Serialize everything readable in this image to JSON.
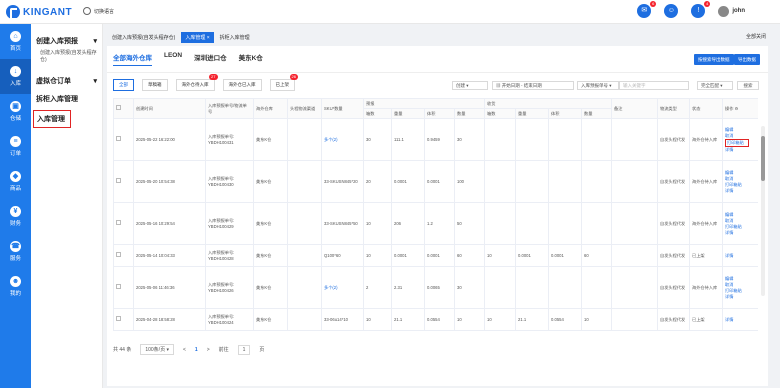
{
  "brand": {
    "name": "KINGANT",
    "lang_label": "切换语言"
  },
  "header": {
    "badges": [
      "6",
      "",
      "4"
    ],
    "user": "john"
  },
  "sidebar": [
    {
      "label": "首页",
      "icon": "home-icon"
    },
    {
      "label": "入库",
      "icon": "inbound-icon"
    },
    {
      "label": "仓储",
      "icon": "warehouse-icon"
    },
    {
      "label": "订单",
      "icon": "order-icon"
    },
    {
      "label": "商品",
      "icon": "goods-icon"
    },
    {
      "label": "财务",
      "icon": "finance-icon"
    },
    {
      "label": "服务",
      "icon": "service-icon"
    },
    {
      "label": "我的",
      "icon": "user-icon"
    }
  ],
  "submenu": {
    "s1": "创建入库预报",
    "s1_child": "创建入库预报(自发头程存仓)",
    "s2": "虚拟仓订单",
    "s3": "拆柜入库管理",
    "s4": "入库管理"
  },
  "page_tabs": [
    "创建入库预报(自发头程存仓)",
    "入库管理",
    "拆柜入库管理"
  ],
  "close_all": "全部关闭",
  "warehouse_tabs": [
    "全部海外仓库",
    "LEON",
    "深圳进口仓",
    "美东K仓"
  ],
  "actions": {
    "export_current": "按搜索导出数据",
    "export_all": "导出数据"
  },
  "filters": [
    {
      "label": "全部",
      "badge": ""
    },
    {
      "label": "草稿箱",
      "badge": ""
    },
    {
      "label": "海外仓待入库",
      "badge": "27"
    },
    {
      "label": "海外仓已入库",
      "badge": ""
    },
    {
      "label": "已上架",
      "badge": "26"
    }
  ],
  "search": {
    "date_type": "创建",
    "date_from": "开始日期",
    "date_sep": "-",
    "date_to": "结束日期",
    "field": "入库预报单号",
    "placeholder": "输入关键字",
    "match": "完全匹配",
    "button": "搜索"
  },
  "table": {
    "headers": [
      "创建时间",
      "入库预报单号/物流单号",
      "海外仓库",
      "头程物流渠道",
      "SKU*数量",
      "预报",
      "收货",
      "备注",
      "物流类型",
      "状态",
      "操作"
    ],
    "sub_headers": [
      "箱数",
      "重量",
      "体积",
      "数量",
      "箱数",
      "重量",
      "体积",
      "数量"
    ],
    "rows": [
      {
        "time": "2025-05-22 16:22:00",
        "no": "入库预报单号: YBDH100431",
        "wh": "美东K仓",
        "sku": "多个(2)",
        "f": [
          "30",
          "111.1",
          "0.9459",
          "30"
        ],
        "r": [
          "",
          "",
          "",
          ""
        ],
        "type": "自发头程代发",
        "status": "海外仓待入库",
        "ops": [
          "编辑",
          "取消",
          "打印箱贴",
          "详情"
        ],
        "hl": 2
      },
      {
        "time": "2025-05-20 10:54:38",
        "no": "入库预报单号: YBDH100430",
        "wh": "美东K仓",
        "sku": "33-SKUSN845*20",
        "f": [
          "20",
          "0.0001",
          "0.0001",
          "100"
        ],
        "r": [
          "",
          "",
          "",
          ""
        ],
        "type": "自发头程代发",
        "status": "海外仓待入库",
        "ops": [
          "编辑",
          "取消",
          "打印箱贴",
          "详情"
        ],
        "hl": -1
      },
      {
        "time": "2025-05-16 10:29:54",
        "no": "入库预报单号: YBDH100429",
        "wh": "美东K仓",
        "sku": "33-SKUSN845*50",
        "f": [
          "10",
          "206",
          "1.2",
          "50"
        ],
        "r": [
          "",
          "",
          "",
          ""
        ],
        "type": "自发头程代发",
        "status": "海外仓待入库",
        "ops": [
          "编辑",
          "取消",
          "打印箱贴",
          "详情"
        ],
        "hl": -1
      },
      {
        "time": "2025-05-14 10:04:33",
        "no": "入库预报单号: YBDH100428",
        "wh": "美东K仓",
        "sku": "Q100*60",
        "f": [
          "10",
          "0.0001",
          "0.0001",
          "60"
        ],
        "r": [
          "10",
          "0.0001",
          "0.0001",
          "60"
        ],
        "type": "自发头程代发",
        "status": "已上架",
        "ops": [
          "详情"
        ],
        "hl": -1
      },
      {
        "time": "2025-05-06 11:46:36",
        "no": "入库预报单号: YBDH100426",
        "wh": "美东K仓",
        "sku": "多个(2)",
        "f": [
          "2",
          "2.31",
          "0.0065",
          "30"
        ],
        "r": [
          "",
          "",
          "",
          ""
        ],
        "type": "自发头程代发",
        "status": "海外仓待入库",
        "ops": [
          "编辑",
          "取消",
          "打印箱贴",
          "详情"
        ],
        "hl": -1
      },
      {
        "time": "2025-04-28 18:58:28",
        "no": "入库预报单号: YBDH100424",
        "wh": "美东K仓",
        "sku": "33-06u14*10",
        "f": [
          "10",
          "21.1",
          "0.0554",
          "10"
        ],
        "r": [
          "10",
          "21.1",
          "0.0554",
          "10"
        ],
        "type": "自发头程代发",
        "status": "已上架",
        "ops": [
          "详情"
        ],
        "hl": -1
      }
    ]
  },
  "pager": {
    "total": "共 44 条",
    "size": "100条/页",
    "prev": "<",
    "page": "1",
    "next": ">",
    "goto": "前往",
    "goto_val": "1",
    "page_unit": "页"
  }
}
